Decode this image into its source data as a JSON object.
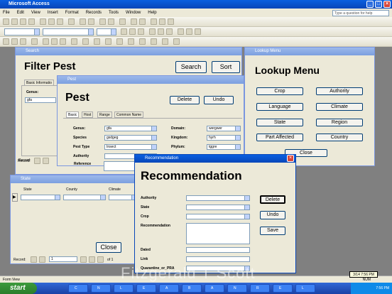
{
  "app": {
    "title": "Microsoft Access",
    "help_placeholder": "Type a question for help"
  },
  "menu": [
    "File",
    "Edit",
    "View",
    "Insert",
    "Format",
    "Records",
    "Tools",
    "Window",
    "Help"
  ],
  "search_win": {
    "title": "Search",
    "heading": "Filter Pest",
    "search_btn": "Search",
    "sort_btn": "Sort",
    "tab": "Basic Informatio",
    "genus_label": "Genus:",
    "genus_value": "gfa",
    "record_label": "Record:"
  },
  "pest_win": {
    "title": "Pest",
    "heading": "Pest",
    "delete_btn": "Delete",
    "undo_btn": "Undo",
    "tabs": [
      "Basic",
      "Host",
      "Range",
      "Common Name"
    ],
    "fields": {
      "genus": {
        "label": "Genus:",
        "value": "gfa"
      },
      "species": {
        "label": "Species",
        "value": "gsdgeg"
      },
      "pest_type": {
        "label": "Pest Type",
        "value": "Insect"
      },
      "authority": {
        "label": "Authority",
        "value": ""
      },
      "reference": {
        "label": "Reference",
        "value": ""
      },
      "domain": {
        "label": "Domain:",
        "value": "wergwer"
      },
      "kingdom": {
        "label": "Kingdom:",
        "value": "hyrh"
      },
      "phylum": {
        "label": "Phylum:",
        "value": "tggre"
      }
    },
    "record_label": "Record:"
  },
  "lookup_win": {
    "title": "Lookup Menu",
    "heading": "Lookup Menu",
    "buttons": [
      "Crop",
      "Authority",
      "Language",
      "Climate",
      "State",
      "Region",
      "Part Affected",
      "Country"
    ],
    "close": "Close"
  },
  "state_win": {
    "title": "State",
    "columns": [
      "State",
      "County",
      "Climate"
    ],
    "close": "Close",
    "record_label": "Record:",
    "record_num": "1",
    "of_label": "of",
    "of_count": "1"
  },
  "rec_win": {
    "title": "Recommendation",
    "heading": "Recommendation",
    "fields": [
      "Authority",
      "State",
      "Crop",
      "Recommendation",
      "Dated",
      "Link",
      "Quarantine_or_PRA"
    ],
    "delete_btn": "Delete",
    "undo_btn": "Undo",
    "save_btn": "Save"
  },
  "status": {
    "left": "Form View",
    "right": "NUM"
  },
  "taskbar": {
    "start": "start",
    "time": "7:56 PM",
    "date": "3/14",
    "tasks": [
      "C",
      "N",
      "L",
      "E",
      "A",
      "B",
      "A",
      "N",
      "R",
      "E",
      "L"
    ]
  },
  "watermark": "Fitzgerald T Scott"
}
